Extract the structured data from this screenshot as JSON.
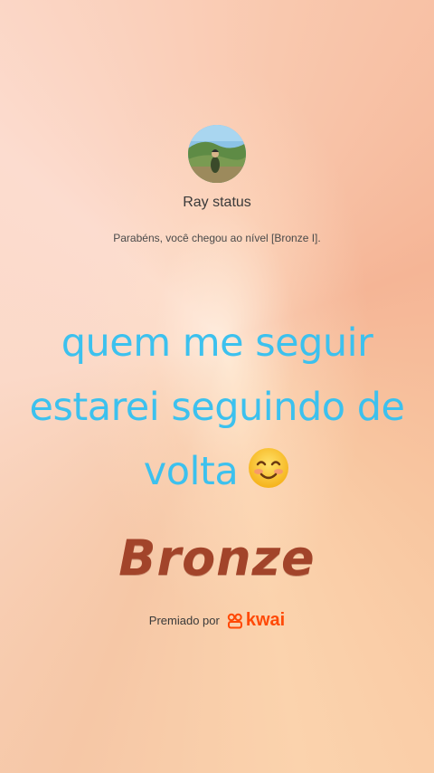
{
  "profile": {
    "username": "Ray status",
    "message": "Parabéns, você chegou ao nível [Bronze I]."
  },
  "caption": {
    "line1": "quem me seguir",
    "line2": "estarei seguindo de",
    "line3": "volta",
    "emoji": "smiling-face-icon"
  },
  "badge": {
    "title": "Bronze"
  },
  "award": {
    "label": "Premiado por",
    "brand": "kwai",
    "brand_color": "#ff4906"
  },
  "colors": {
    "caption": "#3cc1ee",
    "bronze": "#a2442a"
  }
}
